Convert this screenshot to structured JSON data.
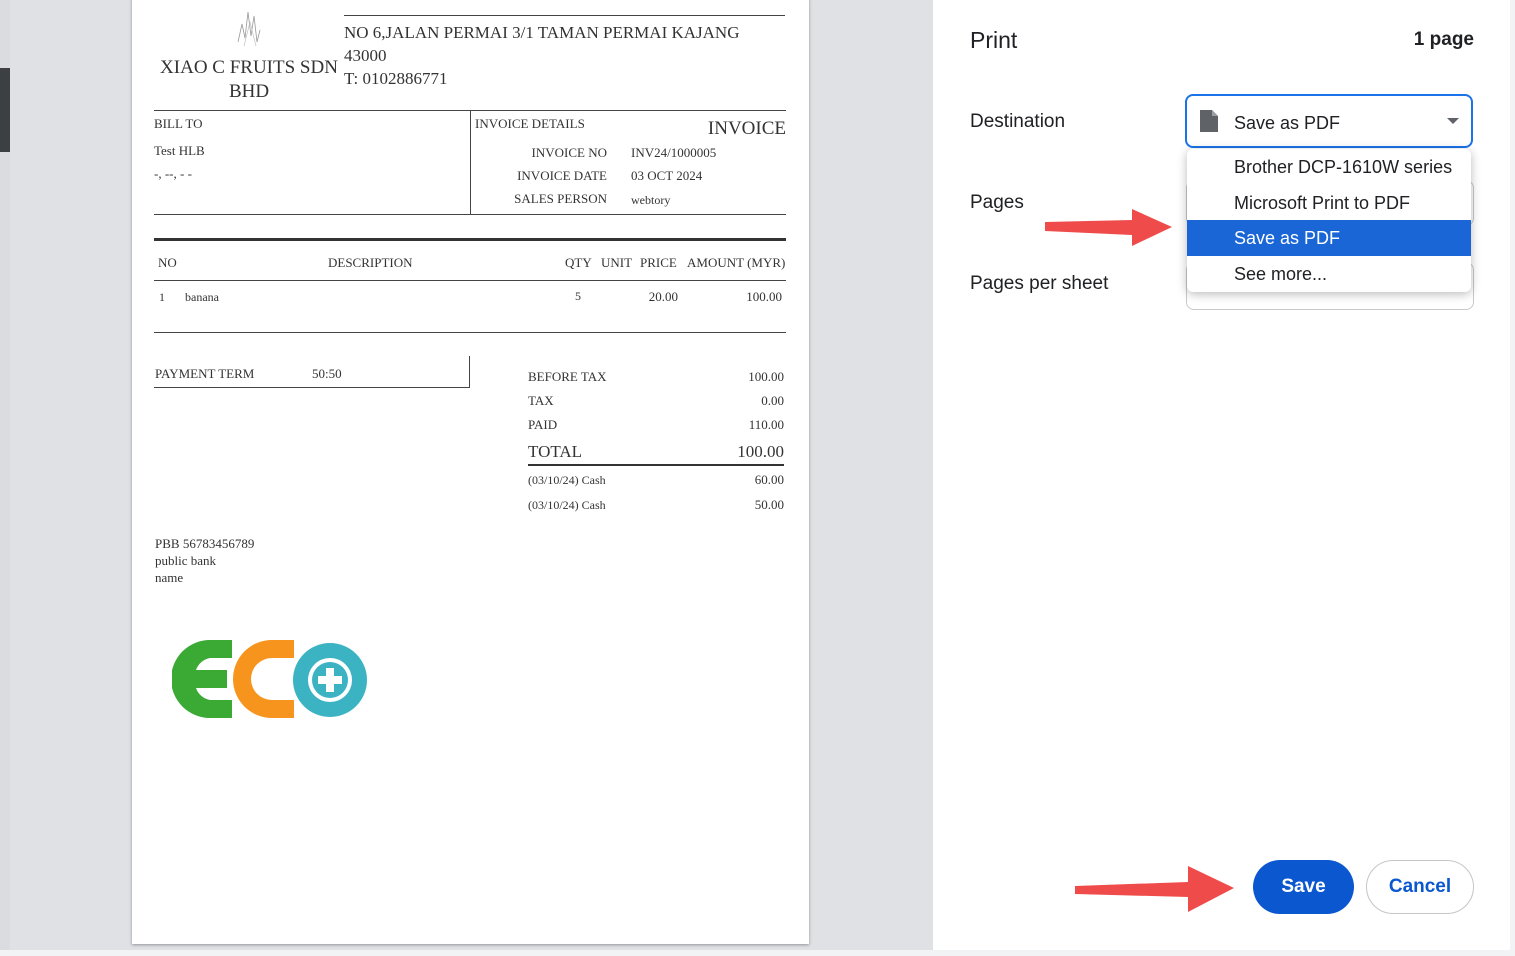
{
  "invoice": {
    "company_name": "XIAO C FRUITS SDN BHD",
    "address": "NO 6,JALAN PERMAI 3/1 TAMAN PERMAI KAJANG 43000",
    "phone": "T: 0102886771",
    "bill_to_label": "BILL TO",
    "bill_to_name": "Test HLB",
    "bill_to_address": "-, --, - -",
    "details_label": "INVOICE DETAILS",
    "doc_title": "INVOICE",
    "invoice_no_label": "INVOICE NO",
    "invoice_no": "INV24/1000005",
    "invoice_date_label": "INVOICE DATE",
    "invoice_date": "03 OCT 2024",
    "sales_person_label": "SALES PERSON",
    "sales_person": "webtory",
    "columns": {
      "no": "NO",
      "description": "DESCRIPTION",
      "qty": "QTY",
      "unit": "UNIT",
      "price": "PRICE",
      "amount": "AMOUNT (MYR)"
    },
    "items": [
      {
        "no": "1",
        "description": "banana",
        "qty": "5",
        "unit": "",
        "price": "20.00",
        "amount": "100.00"
      }
    ],
    "payment_term_label": "PAYMENT TERM",
    "payment_term": "50:50",
    "before_tax_label": "BEFORE TAX",
    "before_tax": "100.00",
    "tax_label": "TAX",
    "tax": "0.00",
    "paid_label": "PAID",
    "paid": "110.00",
    "total_label": "TOTAL",
    "total": "100.00",
    "payments": [
      {
        "label": "(03/10/24) Cash",
        "amount": "60.00"
      },
      {
        "label": "(03/10/24) Cash",
        "amount": "50.00"
      }
    ],
    "bank_account": "PBB 56783456789",
    "bank_name": "public bank",
    "account_name": "name",
    "logo_colors": {
      "e": "#3aaa35",
      "c": "#f7941d",
      "o": "#3bb3c3"
    }
  },
  "print_dialog": {
    "title": "Print",
    "page_count": "1 page",
    "destination_label": "Destination",
    "destination_value": "Save as PDF",
    "pages_label": "Pages",
    "pages_per_sheet_label": "Pages per sheet",
    "destination_options": [
      {
        "label": "Brother DCP-1610W series",
        "selected": false
      },
      {
        "label": "Microsoft Print to PDF",
        "selected": false
      },
      {
        "label": "Save as PDF",
        "selected": true
      },
      {
        "label": "See more...",
        "selected": false
      }
    ],
    "save_label": "Save",
    "cancel_label": "Cancel"
  },
  "colors": {
    "accent": "#1a73e8",
    "primary_button": "#0b57d0",
    "selected_option": "#1a66d6",
    "arrow": "#f04b4b"
  }
}
